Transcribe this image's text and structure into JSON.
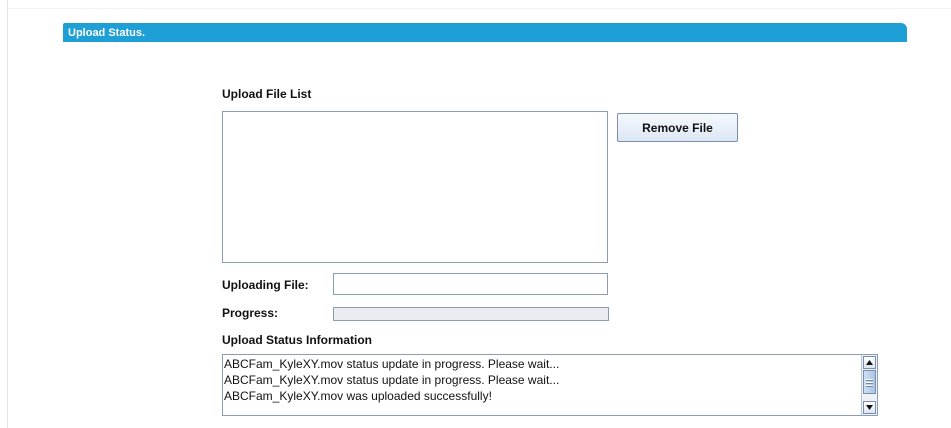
{
  "header": {
    "title": "Upload Status."
  },
  "upload": {
    "file_list_label": "Upload File List",
    "file_list_items": [],
    "remove_file_label": "Remove File",
    "uploading_file_label": "Uploading File:",
    "uploading_file_value": "",
    "progress_label": "Progress:",
    "progress_value": 0
  },
  "status": {
    "label": "Upload Status Information",
    "lines": [
      "ABCFam_KyleXY.mov status update in progress. Please wait...",
      "ABCFam_KyleXY.mov status update in progress. Please wait...",
      "ABCFam_KyleXY.mov was uploaded successfully!"
    ]
  },
  "colors": {
    "header_bar": "#1e9fd6",
    "border": "#8a9db5"
  },
  "icons": {
    "scroll_up": "arrow-up-icon",
    "scroll_down": "arrow-down-icon"
  }
}
